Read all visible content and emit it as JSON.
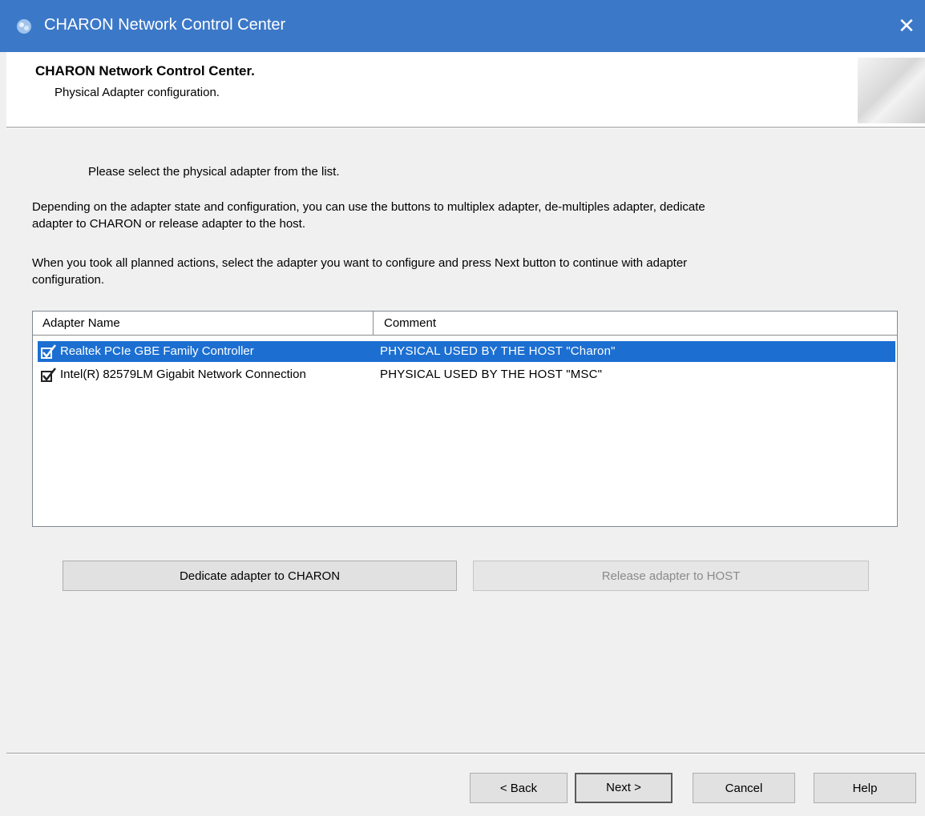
{
  "window": {
    "title": "CHARON Network Control Center",
    "close_glyph": "✕",
    "app_icon": "charon-app-icon"
  },
  "header": {
    "title": "CHARON Network Control Center.",
    "subtitle": "Physical Adapter configuration."
  },
  "instructions": {
    "line1": "Please select the physical adapter from the list.",
    "para2_line1": "Depending on the adapter state and configuration, you can use the buttons to multiplex adapter, de-multiples adapter, dedicate",
    "para2_line2": "adapter to CHARON or release adapter to the host.",
    "para3_line1": "When you took all planned actions, select the adapter you want to configure and press Next button to continue with adapter",
    "para3_line2": "configuration."
  },
  "adapter_list": {
    "columns": [
      "Adapter Name",
      "Comment"
    ],
    "rows": [
      {
        "name": "Realtek PCIe GBE Family Controller",
        "comment": "PHYSICAL USED BY THE HOST \"Charon\"",
        "selected": true,
        "icon": "network-adapter-check-icon"
      },
      {
        "name": "Intel(R) 82579LM Gigabit Network Connection",
        "comment": "PHYSICAL USED BY THE HOST \"MSC\"",
        "selected": false,
        "icon": "network-adapter-check-icon"
      }
    ]
  },
  "actions": {
    "dedicate_label": "Dedicate adapter to CHARON",
    "release_label": "Release adapter to HOST"
  },
  "footer": {
    "back_label": "< Back",
    "next_label": "Next >",
    "cancel_label": "Cancel",
    "help_label": "Help"
  },
  "colors": {
    "titlebar": "#3c78c8",
    "selection": "#1c6fd1"
  }
}
